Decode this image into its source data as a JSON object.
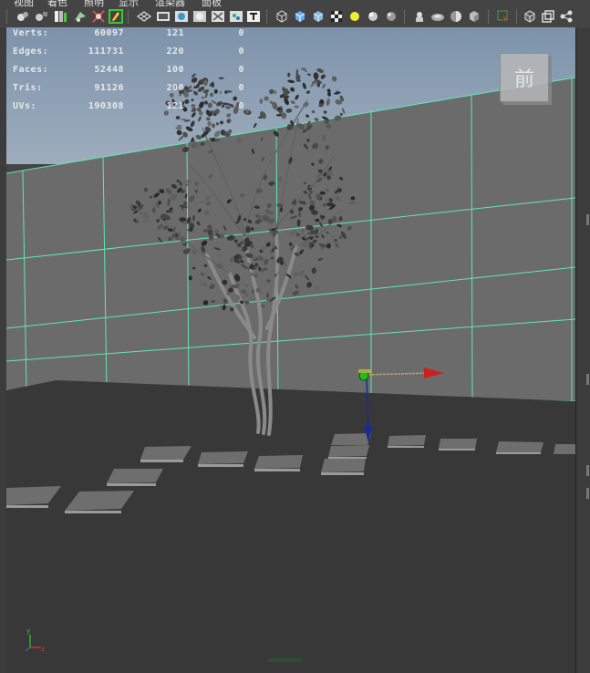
{
  "menu": {
    "items": [
      "视图",
      "着色",
      "照明",
      "显示",
      "渲染器",
      "面板"
    ]
  },
  "toolbar": {
    "icons": [
      "camera-select-icon",
      "camera-attributes-icon",
      "bookmark-icon",
      "image-plane-icon",
      "two-d-pan-icon",
      "grease-pencil-icon",
      "grid-icon",
      "film-gate-icon",
      "resolution-gate-icon",
      "gate-mask-icon",
      "field-chart-icon",
      "safe-action-icon",
      "safe-title-icon",
      "wireframe-icon",
      "smooth-shade-icon",
      "default-material-icon",
      "textured-icon",
      "lights-icon",
      "shadows-icon",
      "ambient-occlusion-icon",
      "motion-blur-icon",
      "isolate-select-icon",
      "xray-icon",
      "xray-joints-icon",
      "xray-active-icon",
      "backface-icon",
      "select-highlight-icon",
      "hud-icon",
      "view-transform-icon"
    ]
  },
  "hud": {
    "rows": [
      {
        "label": "Verts:",
        "v1": "60097",
        "v2": "121",
        "v3": "0"
      },
      {
        "label": "Edges:",
        "v1": "111731",
        "v2": "220",
        "v3": "0"
      },
      {
        "label": "Faces:",
        "v1": "52448",
        "v2": "100",
        "v3": "0"
      },
      {
        "label": "Tris:",
        "v1": "91126",
        "v2": "200",
        "v3": "0"
      },
      {
        "label": "UVs:",
        "v1": "190308",
        "v2": "121",
        "v3": "0"
      }
    ]
  },
  "viewcube": {
    "face_label": "前"
  },
  "axis_gizmo": {
    "y_label": "y",
    "z_label": "z"
  },
  "colors": {
    "grid": "#5fe8b4",
    "sky_top": "#8aa0b8",
    "wall": "#6a6a6a",
    "floor": "#383838",
    "manip_x": "#cc2020",
    "manip_y": "#1a2a9a",
    "manip_center": "#22bb22"
  }
}
